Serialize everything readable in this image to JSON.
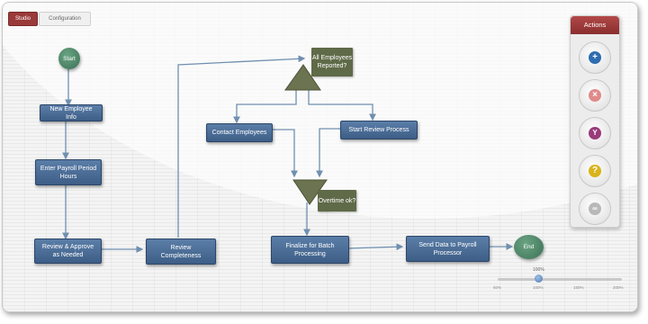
{
  "tabs": [
    {
      "label": "Studio",
      "active": true
    },
    {
      "label": "Configuration",
      "active": false
    }
  ],
  "workflow": {
    "start": "Start",
    "end": "End",
    "steps": {
      "new_employee_info": "New Employee Info",
      "enter_payroll_hours": "Enter Payroll Period Hours",
      "review_approve": "Review & Approve as Needed",
      "review_completeness": "Review Completeness",
      "contact_employees": "Contact Employees",
      "start_review_process": "Start Review Process",
      "finalize_batch": "Finalize for Batch Processing",
      "send_data": "Send Data to Payroll Processor"
    },
    "decisions": {
      "all_reported": "All Employees Reported?",
      "overtime_ok": "Overtime ok?"
    }
  },
  "actions": {
    "title": "Actions",
    "buttons": [
      {
        "icon": "add-icon",
        "color": "#2e6db0"
      },
      {
        "icon": "delete-icon",
        "color": "#e08a8a"
      },
      {
        "icon": "branch-icon",
        "color": "#9a3a7a"
      },
      {
        "icon": "help-icon",
        "color": "#d9b41c"
      },
      {
        "icon": "link-icon",
        "color": "#b8b8b8"
      }
    ]
  },
  "zoom": {
    "value_label": "100%",
    "value_fraction": 0.33,
    "ticks": [
      "50%",
      "100%",
      "150%",
      "200%"
    ]
  },
  "colors": {
    "step_fill": "#4a6d96",
    "start_end_fill": "#4f8a6b",
    "decision_fill": "#6b7350",
    "connector": "#6f8fb0",
    "accent": "#9a3a3a"
  }
}
